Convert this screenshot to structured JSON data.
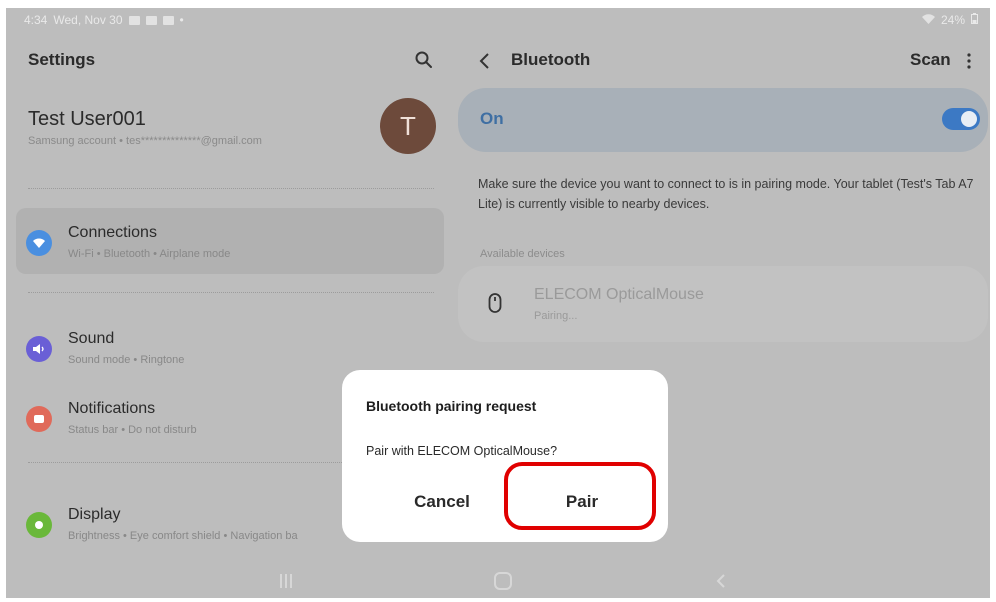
{
  "status_bar": {
    "time": "4:34",
    "date": "Wed, Nov 30",
    "battery": "24%"
  },
  "settings": {
    "title": "Settings",
    "profile": {
      "name": "Test User001",
      "account": "Samsung account  •  tes**************@gmail.com",
      "avatar_letter": "T"
    },
    "items": [
      {
        "title": "Connections",
        "subtitle": "Wi-Fi  •  Bluetooth  •  Airplane mode",
        "icon": "wifi-icon",
        "color": "#4a8fe0"
      },
      {
        "title": "Sound",
        "subtitle": "Sound mode  •  Ringtone",
        "icon": "sound-icon",
        "color": "#6a5fd6"
      },
      {
        "title": "Notifications",
        "subtitle": "Status bar  •  Do not disturb",
        "icon": "notification-icon",
        "color": "#e06a5a"
      },
      {
        "title": "Display",
        "subtitle": "Brightness  •  Eye comfort shield  •  Navigation ba",
        "icon": "display-icon",
        "color": "#6ab83a"
      }
    ]
  },
  "bluetooth": {
    "title": "Bluetooth",
    "scan_label": "Scan",
    "on_label": "On",
    "info": "Make sure the device you want to connect to is in pairing mode. Your tablet (Test's Tab A7 Lite) is currently visible to nearby devices.",
    "available_label": "Available devices",
    "device": {
      "name": "ELECOM OpticalMouse",
      "status": "Pairing..."
    }
  },
  "dialog": {
    "title": "Bluetooth pairing request",
    "message": "Pair with ELECOM OpticalMouse?",
    "cancel": "Cancel",
    "pair": "Pair"
  },
  "colors": {
    "accent": "#3c79c4",
    "highlight": "#e00000"
  }
}
